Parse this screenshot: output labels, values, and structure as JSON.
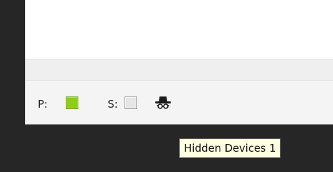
{
  "status_bar": {
    "primary_label": "P:",
    "primary_color": "#8ecc1b",
    "secondary_label": "S:",
    "secondary_color": "#e6e6e6",
    "hidden_devices_icon": "spy-icon"
  },
  "tooltip": {
    "text": "Hidden Devices 1"
  }
}
